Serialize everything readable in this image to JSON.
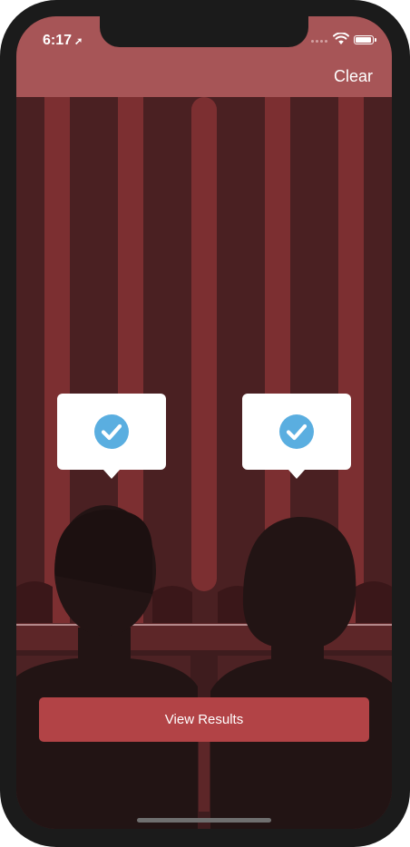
{
  "status_bar": {
    "time": "6:17",
    "location_arrow": "➚"
  },
  "nav": {
    "clear_label": "Clear"
  },
  "main": {
    "view_results_label": "View Results"
  },
  "colors": {
    "navbar": "#a75557",
    "curtain_dark": "#4a2022",
    "curtain_stripe": "#7c2f31",
    "button": "#b24346",
    "check": "#5aaee0"
  },
  "icons": {
    "seat_left": "check-circle-icon",
    "seat_right": "check-circle-icon"
  }
}
